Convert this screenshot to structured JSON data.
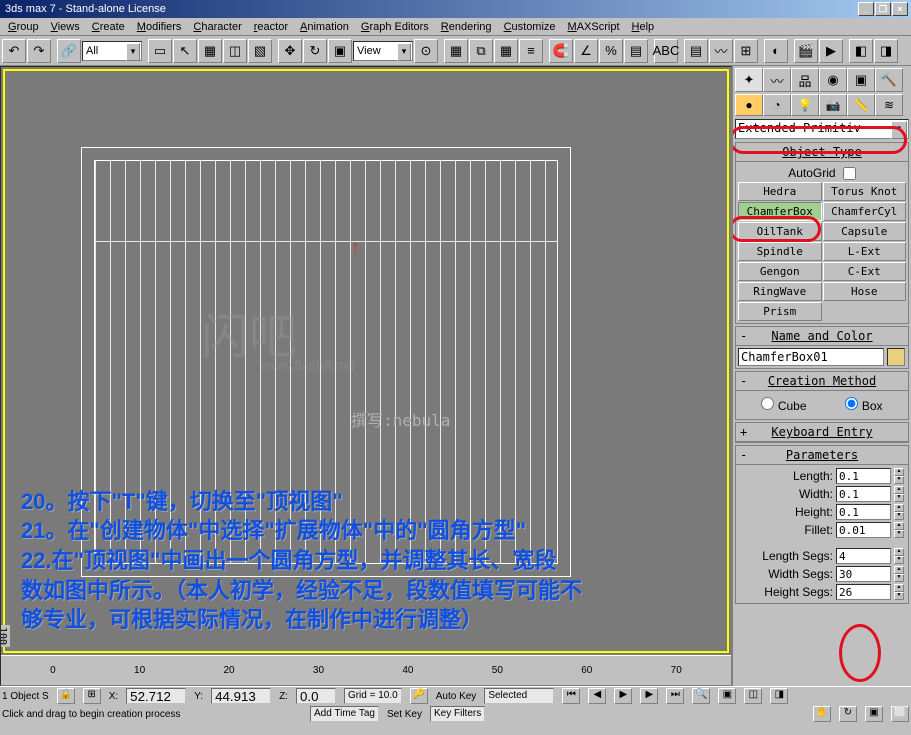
{
  "title": "3ds max 7 - Stand-alone License",
  "menus": [
    "Group",
    "Views",
    "Create",
    "Modifiers",
    "Character",
    "reactor",
    "Animation",
    "Graph Editors",
    "Rendering",
    "Customize",
    "MAXScript",
    "Help"
  ],
  "toolbar": {
    "selection_filter": "All",
    "ref_coord": "View"
  },
  "watermark": {
    "main": "闪吧",
    "sub": "www.flash8.net"
  },
  "author": "撰写:nebula",
  "tutorial": {
    "l1": "20。按下\"T\"键，切换至\"顶视图\"",
    "l2": "21。在\"创建物体\"中选择\"扩展物体\"中的\"圆角方型\"",
    "l3": "22.在\"顶视图\"中画出一个圆角方型，并调整其长、宽段",
    "l4": "数如图中所示。（本人初学，经验不足，段数值填写可能不",
    "l5": "够专业，可根据实际情况，在制作中进行调整）"
  },
  "ruler_ticks": [
    "0",
    "10",
    "20",
    "30",
    "40",
    "50",
    "60",
    "70",
    "100"
  ],
  "panel": {
    "category": "Extended Primitiv",
    "object_type_header": "Object Type",
    "autogrid_label": "AutoGrid",
    "buttons": {
      "hedra": "Hedra",
      "torusknot": "Torus Knot",
      "chamferbox": "ChamferBox",
      "chamfercyl": "ChamferCyl",
      "oiltank": "OilTank",
      "capsule": "Capsule",
      "spindle": "Spindle",
      "lext": "L-Ext",
      "gengon": "Gengon",
      "cext": "C-Ext",
      "ringwave": "RingWave",
      "hose": "Hose",
      "prism": "Prism"
    },
    "name_header": "Name and Color",
    "object_name": "ChamferBox01",
    "creation_header": "Creation Method",
    "cube_label": "Cube",
    "box_label": "Box",
    "keyboard_header": "Keyboard Entry",
    "params_header": "Parameters",
    "params": {
      "length_label": "Length:",
      "length_val": "0.1",
      "width_label": "Width:",
      "width_val": "0.1",
      "height_label": "Height:",
      "height_val": "0.1",
      "fillet_label": "Fillet:",
      "fillet_val": "0.01",
      "lseg_label": "Length Segs:",
      "lseg_val": "4",
      "wseg_label": "Width Segs:",
      "wseg_val": "30",
      "hseg_label": "Height Segs:",
      "hseg_val": "26"
    }
  },
  "status": {
    "objects": "1 Object S",
    "x_val": "52.712",
    "y_val": "44.913",
    "z_val": "0.0",
    "grid": "Grid = 10.0",
    "autokey": "Auto Key",
    "selected": "Selected",
    "setkey": "Set Key",
    "keyfilters": "Key Filters",
    "prompt": "Click and drag to begin creation process",
    "timetag": "Add Time Tag"
  }
}
